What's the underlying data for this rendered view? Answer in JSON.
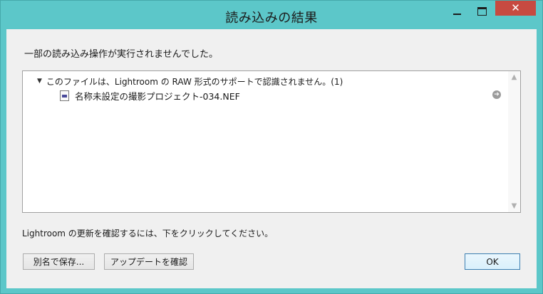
{
  "window": {
    "title": "読み込みの結果",
    "close_symbol": "✕"
  },
  "message": "一部の読み込み操作が実行されませんでした。",
  "results": {
    "group_toggle": "▼",
    "group_label": "このファイルは、Lightroom の RAW 形式のサポートで認識されません。(1)",
    "items": [
      {
        "label": "名称未設定の撮影プロジェクト-034.NEF",
        "action_symbol": "➔"
      }
    ],
    "scroll_up_symbol": "▲",
    "scroll_down_symbol": "▼"
  },
  "update_text": "Lightroom の更新を確認するには、下をクリックしてください。",
  "buttons": {
    "save_as": "別名で保存...",
    "check_updates": "アップデートを確認",
    "ok": "OK"
  },
  "colors": {
    "frame": "#5cc7c9",
    "close_button": "#c74a41",
    "client": "#f0f0f0"
  },
  "icons": {
    "minimize": "minimize-icon",
    "maximize": "maximize-icon",
    "close": "close-icon",
    "file": "raw-file-icon",
    "reveal": "reveal-arrow-icon"
  }
}
